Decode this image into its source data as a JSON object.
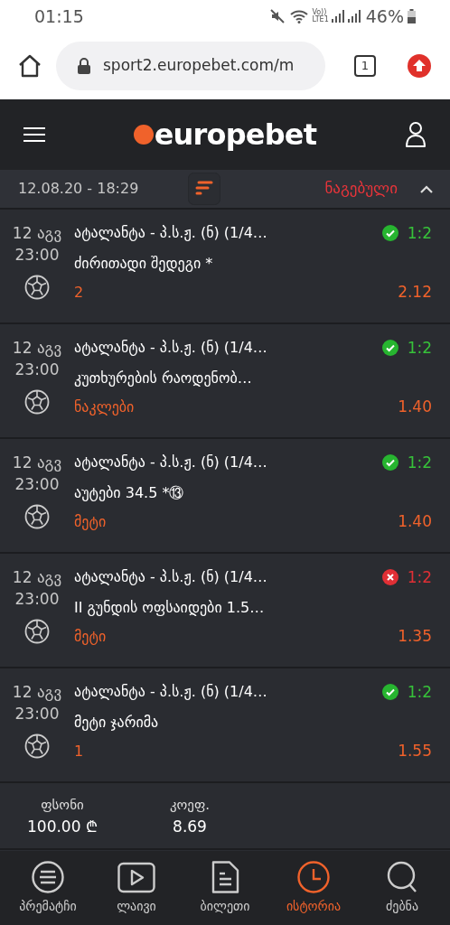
{
  "status_bar": {
    "time": "01:15",
    "network_top": "Vo))",
    "network_bottom": "LTE1",
    "battery": "46%"
  },
  "browser": {
    "url": "sport2.europebet.com/m",
    "tab_count": "1"
  },
  "app_header": {
    "logo": "europebet"
  },
  "ticket": {
    "date": "12.08.20 - 18:29",
    "status": "ნაგებული",
    "expanded": true,
    "bets": [
      {
        "date": "12 აგვ",
        "time": "23:00",
        "match": "ატალანტა - პ.ს.ჟ. (ნ) (1/4…",
        "market": "ძირითადი შედეგი *",
        "pick": "2",
        "kind": "won",
        "score": "1:2",
        "odds": "2.12"
      },
      {
        "date": "12 აგვ",
        "time": "23:00",
        "match": "ატალანტა - პ.ს.ჟ. (ნ) (1/4…",
        "market": "კუთხურების რაოდენობ…",
        "pick": "ნაკლები",
        "kind": "won",
        "score": "1:2",
        "odds": "1.40"
      },
      {
        "date": "12 აგვ",
        "time": "23:00",
        "match": "ატალანტა - პ.ს.ჟ. (ნ) (1/4…",
        "market": "აუტები 34.5 *⑬",
        "pick": "მეტი",
        "kind": "won",
        "score": "1:2",
        "odds": "1.40"
      },
      {
        "date": "12 აგვ",
        "time": "23:00",
        "match": "ატალანტა - პ.ს.ჟ. (ნ) (1/4…",
        "market": "II გუნდის ოფსაიდები 1.5…",
        "pick": "მეტი",
        "kind": "lost",
        "score": "1:2",
        "odds": "1.35"
      },
      {
        "date": "12 აგვ",
        "time": "23:00",
        "match": "ატალანტა - პ.ს.ჟ. (ნ) (1/4…",
        "market": "მეტი ჯარიმა",
        "pick": "1",
        "kind": "won",
        "score": "1:2",
        "odds": "1.55"
      }
    ],
    "summary": [
      {
        "label": "ფსონი",
        "value": "100.00 ₾"
      },
      {
        "label": "კოეფ.",
        "value": "8.69"
      }
    ]
  },
  "bottom_nav": [
    {
      "kind": "prematch",
      "label": "პრემატჩი",
      "selected": false
    },
    {
      "kind": "live",
      "label": "ლაივი",
      "selected": false
    },
    {
      "kind": "ticket",
      "label": "ბილეთი",
      "selected": false
    },
    {
      "kind": "history",
      "label": "ისტორია",
      "selected": true
    },
    {
      "kind": "search",
      "label": "ძებნა",
      "selected": false
    }
  ]
}
